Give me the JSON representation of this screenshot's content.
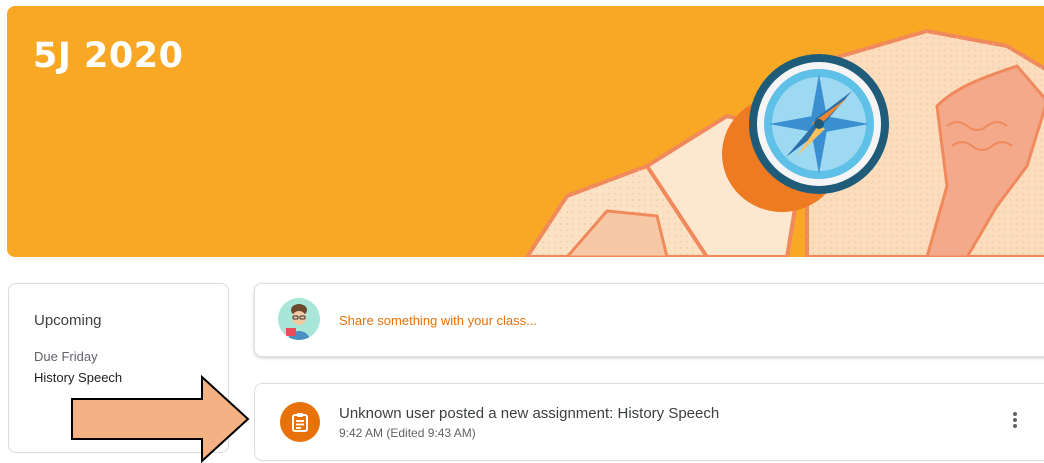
{
  "class": {
    "title": "5J 2020"
  },
  "upcoming": {
    "title": "Upcoming",
    "due_label": "Due Friday",
    "item": "History Speech"
  },
  "share": {
    "placeholder": "Share something with your class..."
  },
  "post": {
    "title": "Unknown user posted a new assignment: History Speech",
    "time": "9:42 AM (Edited 9:43 AM)",
    "icon": "assignment-icon",
    "menu_icon": "more-vert-icon"
  },
  "colors": {
    "banner": "#f9a825",
    "accent": "#e8710a",
    "arrow": "#f4b183"
  }
}
